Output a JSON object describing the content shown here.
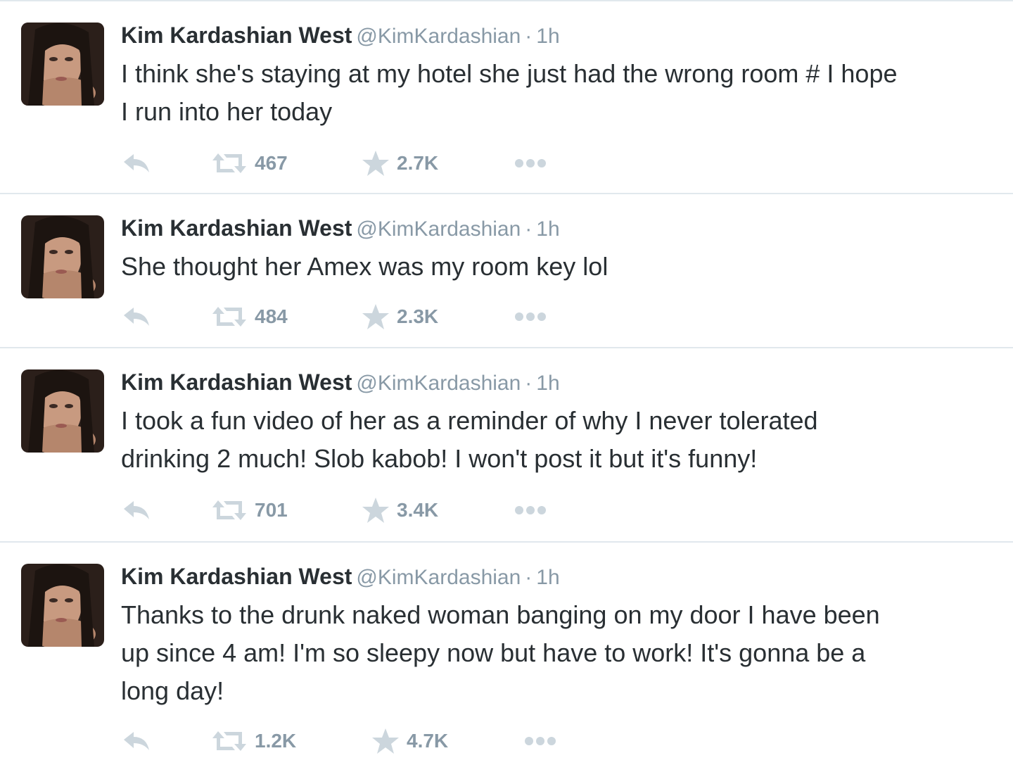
{
  "colors": {
    "text": "#292f33",
    "muted": "#8899a6",
    "icon": "#ccd6dd",
    "divider": "#e1e8ed"
  },
  "tweets": [
    {
      "fullname": "Kim Kardashian West",
      "username": "@KimKardashian",
      "separator": "·",
      "time": "1h",
      "text": "I think she's staying at my hotel she just had the wrong room # I hope\nI run into her today",
      "reply_icon": "reply-icon",
      "retweet_icon": "retweet-icon",
      "retweets": "467",
      "favorite_icon": "star-icon",
      "favorites": "2.7K",
      "more_icon": "more-dots-icon"
    },
    {
      "fullname": "Kim Kardashian West",
      "username": "@KimKardashian",
      "separator": "·",
      "time": "1h",
      "text": "She thought her Amex was my room key lol",
      "reply_icon": "reply-icon",
      "retweet_icon": "retweet-icon",
      "retweets": "484",
      "favorite_icon": "star-icon",
      "favorites": "2.3K",
      "more_icon": "more-dots-icon"
    },
    {
      "fullname": "Kim Kardashian West",
      "username": "@KimKardashian",
      "separator": "·",
      "time": "1h",
      "text": "I took a fun video of her as a reminder of why I never tolerated\ndrinking 2 much! Slob kabob! I won't post it but it's funny!",
      "reply_icon": "reply-icon",
      "retweet_icon": "retweet-icon",
      "retweets": "701",
      "favorite_icon": "star-icon",
      "favorites": "3.4K",
      "more_icon": "more-dots-icon"
    },
    {
      "fullname": "Kim Kardashian West",
      "username": "@KimKardashian",
      "separator": "·",
      "time": "1h",
      "text": "Thanks to the drunk naked woman banging on my door I have been\nup since 4 am! I'm so sleepy now but have to work! It's gonna be a\nlong day!",
      "reply_icon": "reply-icon",
      "retweet_icon": "retweet-icon",
      "retweets": "1.2K",
      "favorite_icon": "star-icon",
      "favorites": "4.7K",
      "more_icon": "more-dots-icon"
    }
  ]
}
